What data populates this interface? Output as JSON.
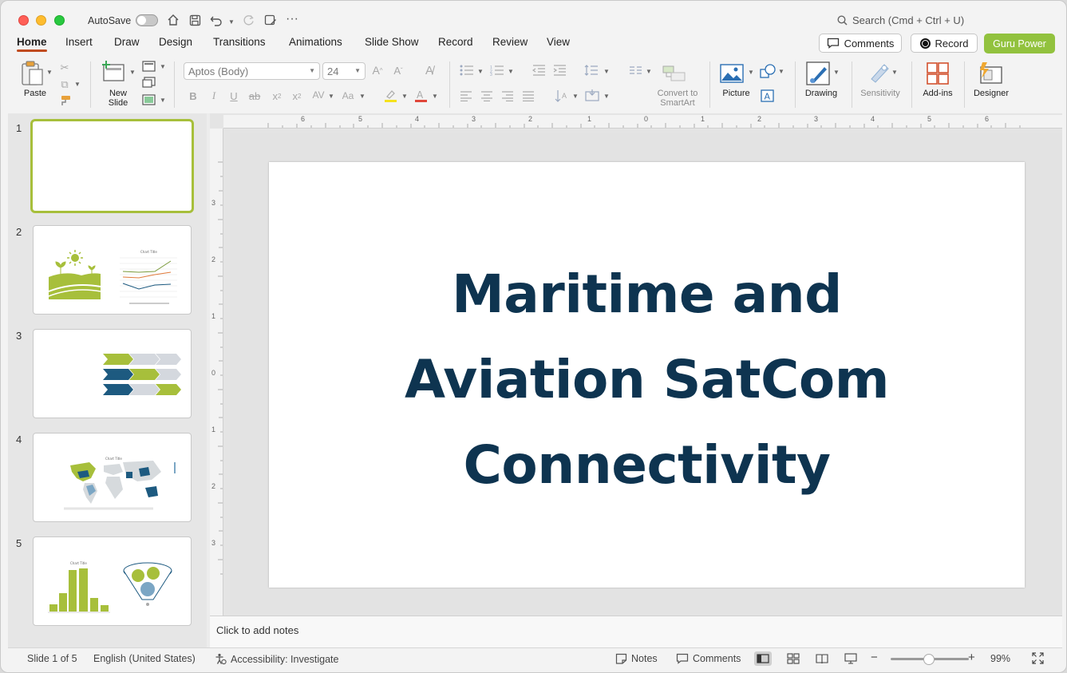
{
  "window": {
    "autosave_label": "AutoSave",
    "search_placeholder": "Search (Cmd + Ctrl + U)"
  },
  "tabs": [
    "Home",
    "Insert",
    "Draw",
    "Design",
    "Transitions",
    "Animations",
    "Slide Show",
    "Record",
    "Review",
    "View"
  ],
  "active_tab": "Home",
  "header_buttons": {
    "comments": "Comments",
    "record": "Record",
    "guru": "Guru Power"
  },
  "ribbon": {
    "paste": "Paste",
    "new_slide_line1": "New",
    "new_slide_line2": "Slide",
    "font_name": "Aptos (Body)",
    "font_size": "24",
    "convert_line1": "Convert to",
    "convert_line2": "SmartArt",
    "picture": "Picture",
    "drawing": "Drawing",
    "sensitivity": "Sensitivity",
    "addins": "Add-ins",
    "designer": "Designer"
  },
  "ruler": {
    "h_ticks": [
      "6",
      "5",
      "4",
      "3",
      "2",
      "1",
      "0",
      "1",
      "2",
      "3",
      "4",
      "5",
      "6"
    ],
    "v_ticks": [
      "3",
      "2",
      "1",
      "0",
      "1",
      "2",
      "3"
    ]
  },
  "slides": [
    {
      "number": "1"
    },
    {
      "number": "2",
      "chart_title": "Chart Title"
    },
    {
      "number": "3"
    },
    {
      "number": "4",
      "chart_title": "Chart Title"
    },
    {
      "number": "5",
      "chart_title": "Chart Title"
    }
  ],
  "current_slide": {
    "title_lines": [
      "Maritime and",
      "Aviation SatCom",
      "Connectivity"
    ]
  },
  "notes_placeholder": "Click to add notes",
  "status": {
    "slide_info": "Slide 1 of 5",
    "language": "English (United States)",
    "accessibility": "Accessibility: Investigate",
    "notes": "Notes",
    "comments": "Comments",
    "zoom": "99%"
  },
  "colors": {
    "accent_green": "#92c23e",
    "title_navy": "#0e3450",
    "tab_underline": "#c04b1f"
  }
}
